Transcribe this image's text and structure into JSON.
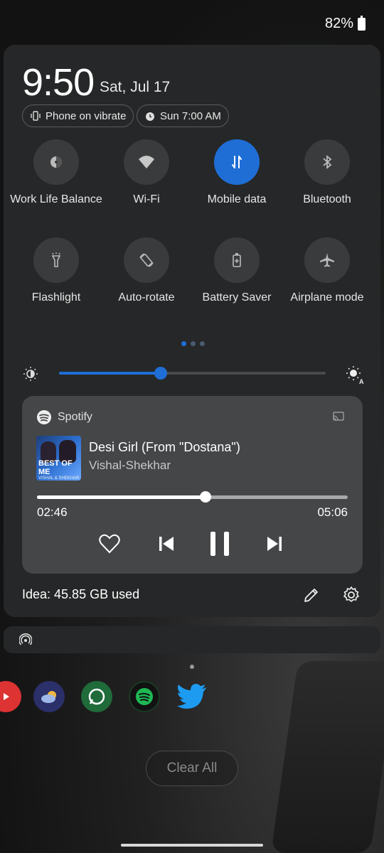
{
  "status_bar": {
    "battery": "82%"
  },
  "header": {
    "time": "9:50",
    "date": "Sat, Jul 17",
    "chips": [
      {
        "label": "Phone on vibrate",
        "icon": "vibrate-icon"
      },
      {
        "label": "Sun 7:00 AM",
        "icon": "alarm-icon"
      }
    ]
  },
  "tiles": [
    {
      "label": "Work Life Balance",
      "icon": "work-life-balance-icon",
      "active": false
    },
    {
      "label": "Wi-Fi",
      "icon": "wifi-icon",
      "active": false
    },
    {
      "label": "Mobile data",
      "icon": "mobile-data-icon",
      "active": true
    },
    {
      "label": "Bluetooth",
      "icon": "bluetooth-icon",
      "active": false
    },
    {
      "label": "Flashlight",
      "icon": "flashlight-icon",
      "active": false
    },
    {
      "label": "Auto-rotate",
      "icon": "auto-rotate-icon",
      "active": false
    },
    {
      "label": "Battery Saver",
      "icon": "battery-saver-icon",
      "active": false
    },
    {
      "label": "Airplane mode",
      "icon": "airplane-icon",
      "active": false
    }
  ],
  "pager": {
    "pages": 3,
    "current": 1
  },
  "brightness": {
    "level": 0.38
  },
  "media": {
    "app": "Spotify",
    "title": "Desi Girl (From \"Dostana\")",
    "artist": "Vishal-Shekhar",
    "album_art_text": "BEST OF ME",
    "album_art_subtext": "VISHAL & SHEKHAR",
    "elapsed": "02:46",
    "duration": "05:06",
    "progress": 0.542
  },
  "footer": {
    "data_usage": "Idea: 45.85 GB used"
  },
  "recents": {
    "clear_all": "Clear All"
  },
  "colors": {
    "accent": "#1e6ed6",
    "panel": "#262728",
    "media_card": "#454648"
  }
}
